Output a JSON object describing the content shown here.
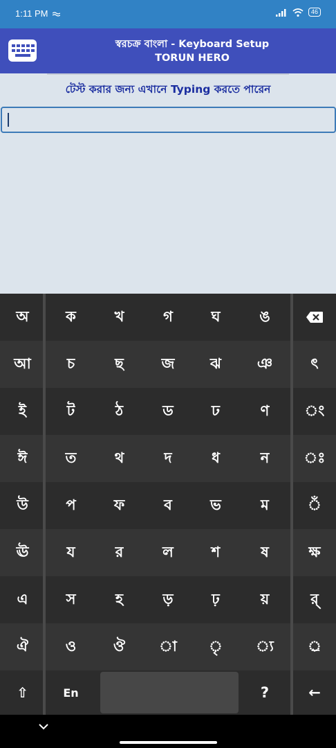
{
  "status": {
    "time": "1:11 PM",
    "battery": "46"
  },
  "app": {
    "title_line1": "স্বরচক্র বাংলা - Keyboard Setup",
    "title_line2": "TORUN HERO"
  },
  "content": {
    "hint": "টেস্ট করার জন্য এখানে Typing করতে পারেন",
    "input_value": ""
  },
  "keyboard": {
    "rows": [
      [
        "অ",
        "ক",
        "খ",
        "গ",
        "ঘ",
        "ঙ",
        "backspace"
      ],
      [
        "আ",
        "চ",
        "ছ",
        "জ",
        "ঝ",
        "ঞ",
        "ৎ"
      ],
      [
        "ই",
        "ট",
        "ঠ",
        "ড",
        "ঢ",
        "ণ",
        "ং"
      ],
      [
        "ঈ",
        "ত",
        "থ",
        "দ",
        "ধ",
        "ন",
        "ঃ"
      ],
      [
        "উ",
        "প",
        "ফ",
        "ব",
        "ভ",
        "ম",
        "ঁ"
      ],
      [
        "ঊ",
        "য",
        "র",
        "ল",
        "শ",
        "ষ",
        "ক্ষ"
      ],
      [
        "এ",
        "স",
        "হ",
        "ড়",
        "ঢ়",
        "য়",
        "র্"
      ],
      [
        "ঐ",
        "ও",
        "ঔ",
        "া",
        "ৃ",
        "্য",
        "্র"
      ]
    ],
    "bottom": {
      "shift": "⇧",
      "lang": "En",
      "space": "",
      "question": "?",
      "enter": "←"
    }
  },
  "colors": {
    "status_bar": "#3182c5",
    "app_bar": "#3f4fbb",
    "hint_text": "#1b2ea0",
    "keyboard_bg": "#2c2c2c"
  }
}
